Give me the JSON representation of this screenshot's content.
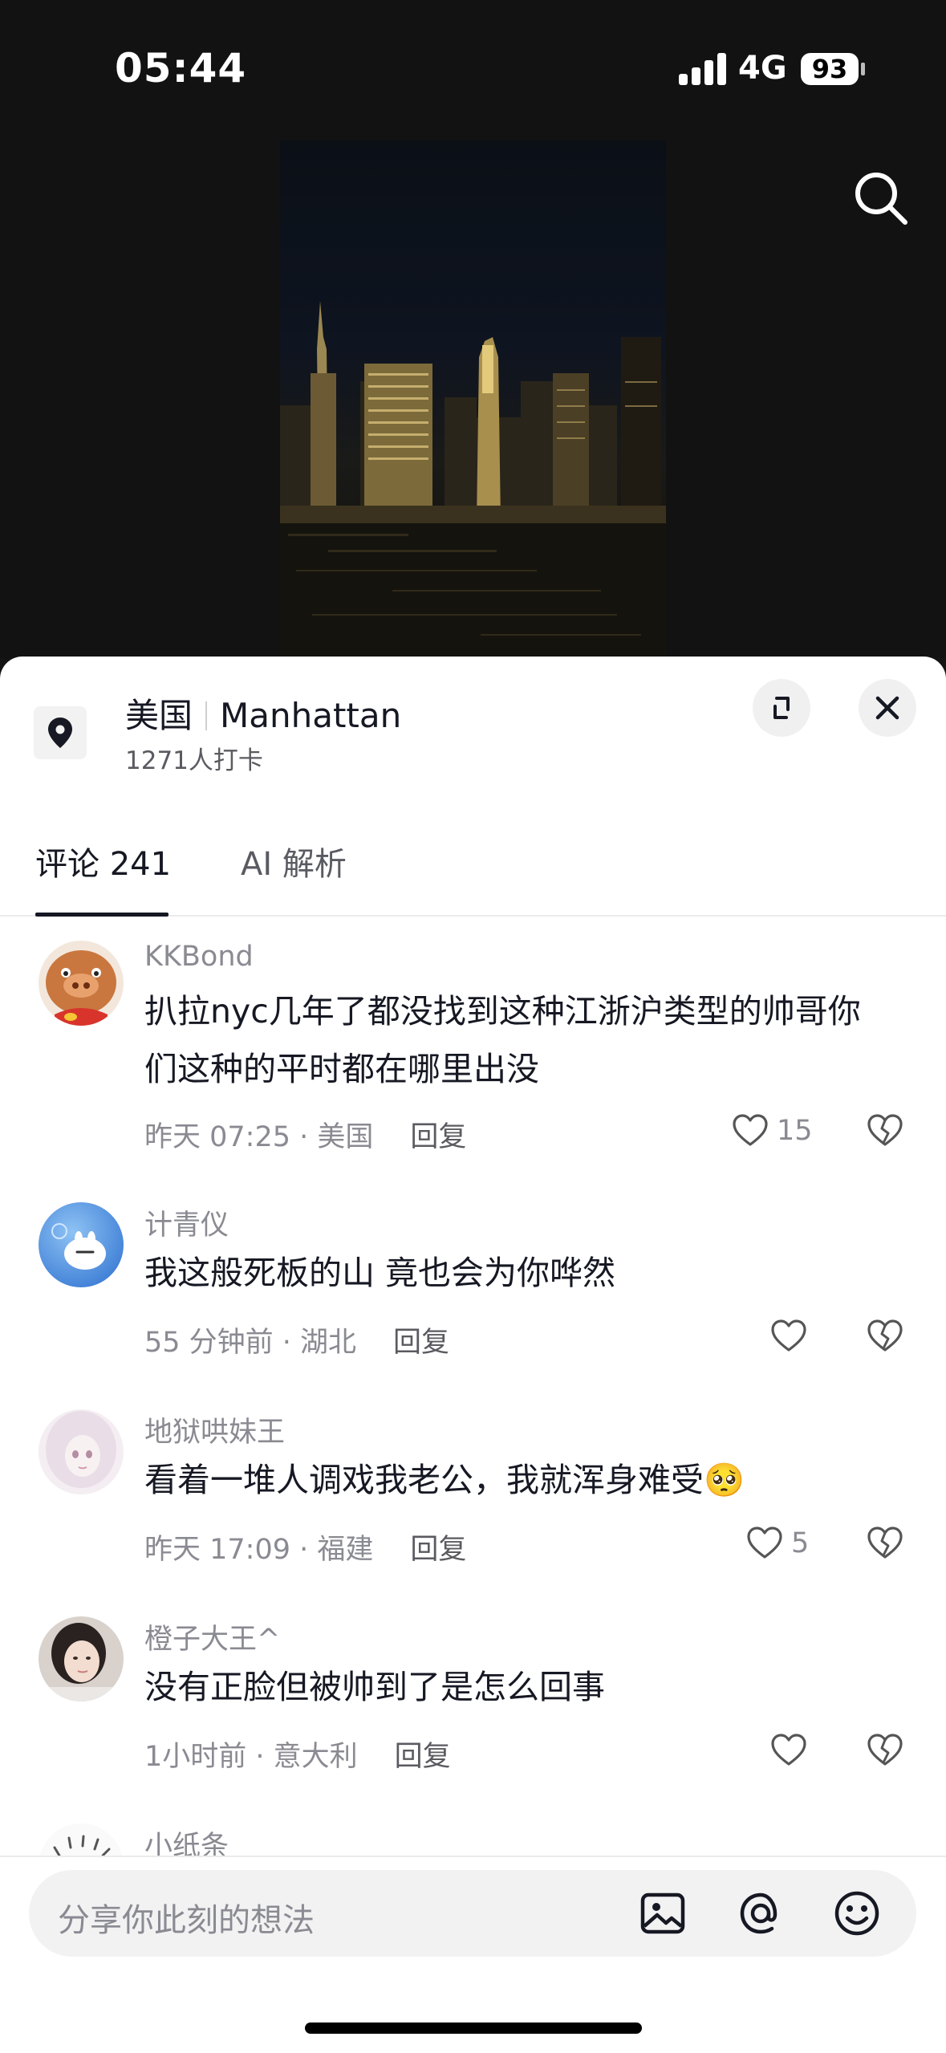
{
  "status_bar": {
    "time": "05:44",
    "network": "4G",
    "battery": "93"
  },
  "location": {
    "country": "美国",
    "place": "Manhattan",
    "checkins": "1271人打卡"
  },
  "tabs": [
    {
      "label": "评论 241",
      "active": true
    },
    {
      "label": "AI 解析",
      "active": false
    }
  ],
  "comments": [
    {
      "user": "KKBond",
      "text": "扒拉nyc几年了都没找到这种江浙沪类型的帅哥你们这种的平时都在哪里出没",
      "meta": "昨天 07:25 · 美国",
      "reply": "回复",
      "likes": "15",
      "avatar": "pig-avatar"
    },
    {
      "user": "计青仪",
      "text": "我这般死板的山 竟也会为你哗然",
      "meta": "55 分钟前 · 湖北",
      "reply": "回复",
      "likes": "",
      "avatar": "blue-cartoon-avatar"
    },
    {
      "user": "地狱哄妹王",
      "text": "看着一堆人调戏我老公，我就浑身难受🥺",
      "meta": "昨天 17:09 · 福建",
      "reply": "回复",
      "likes": "5",
      "avatar": "doll-avatar"
    },
    {
      "user": "橙子大王^",
      "text": "没有正脸但被帅到了是怎么回事",
      "meta": "1小时前 · 意大利",
      "reply": "回复",
      "likes": "",
      "avatar": "girl-photo-avatar"
    },
    {
      "user": "小纸条",
      "avatar": "sketch-avatar"
    }
  ],
  "input": {
    "placeholder": "分享你此刻的想法"
  },
  "icons": [
    "search-icon",
    "location-pin-icon",
    "expand-icon",
    "close-icon",
    "heart-icon",
    "broken-heart-icon",
    "image-icon",
    "at-icon",
    "emoji-icon"
  ]
}
